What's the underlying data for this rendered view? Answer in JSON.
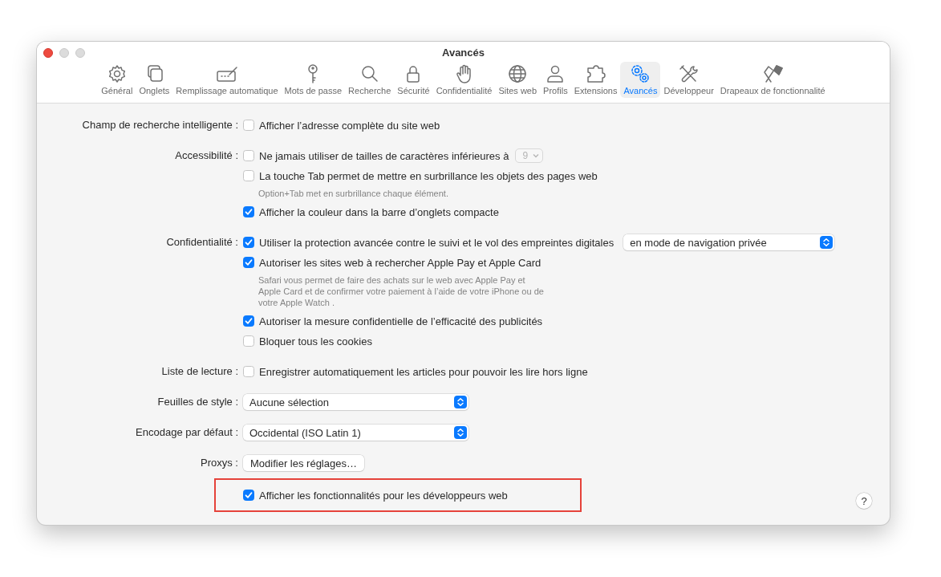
{
  "window": {
    "title": "Avancés"
  },
  "toolbar": [
    {
      "label": "Général",
      "selected": false
    },
    {
      "label": "Onglets",
      "selected": false
    },
    {
      "label": "Remplissage automatique",
      "selected": false
    },
    {
      "label": "Mots de passe",
      "selected": false
    },
    {
      "label": "Recherche",
      "selected": false
    },
    {
      "label": "Sécurité",
      "selected": false
    },
    {
      "label": "Confidentialité",
      "selected": false
    },
    {
      "label": "Sites web",
      "selected": false
    },
    {
      "label": "Profils",
      "selected": false
    },
    {
      "label": "Extensions",
      "selected": false
    },
    {
      "label": "Avancés",
      "selected": true
    },
    {
      "label": "Développeur",
      "selected": false
    },
    {
      "label": "Drapeaux de fonctionnalité",
      "selected": false
    }
  ],
  "sections": [
    {
      "label": "Champ de recherche intelligente :",
      "items": [
        {
          "kind": "checkbox",
          "label": "Afficher l’adresse complète du site web",
          "checked": false
        }
      ]
    },
    {
      "label": "Accessibilité :",
      "items": [
        {
          "kind": "checkbox",
          "label": "Ne jamais utiliser de tailles de caractères inférieures à",
          "checked": false,
          "size_select": {
            "value": "9",
            "disabled": true
          }
        },
        {
          "kind": "checkbox",
          "label": "La touche Tab permet de mettre en surbrillance les objets des pages web",
          "checked": false
        },
        {
          "kind": "note",
          "text": "Option+Tab met en surbrillance chaque élément."
        },
        {
          "kind": "checkbox",
          "label": "Afficher la couleur dans la barre d’onglets compacte",
          "checked": true
        }
      ]
    },
    {
      "label": "Confidentialité :",
      "items": [
        {
          "kind": "checkbox",
          "label": "Utiliser la protection avancée contre le suivi et le vol des empreintes digitales",
          "checked": true,
          "popup": {
            "value": "en mode de navigation privée"
          }
        },
        {
          "kind": "checkbox",
          "label": "Autoriser les sites web à rechercher Apple Pay et Apple Card",
          "checked": true
        },
        {
          "kind": "note",
          "text": "Safari vous permet de faire des achats sur le web avec Apple Pay et\nApple Card et de confirmer votre paiement à l’aide de votre iPhone ou de\nvotre Apple Watch ."
        },
        {
          "kind": "checkbox",
          "label": "Autoriser la mesure confidentielle de l’efficacité des publicités",
          "checked": true
        },
        {
          "kind": "checkbox",
          "label": "Bloquer tous les cookies",
          "checked": false
        }
      ]
    },
    {
      "label": "Liste de lecture :",
      "items": [
        {
          "kind": "checkbox",
          "label": "Enregistrer automatiquement les articles pour pouvoir les lire hors ligne",
          "checked": false
        }
      ]
    },
    {
      "label": "Feuilles de style :",
      "items": [
        {
          "kind": "select",
          "value": "Aucune sélection"
        }
      ]
    },
    {
      "label": "Encodage par défaut :",
      "items": [
        {
          "kind": "select",
          "value": "Occidental (ISO Latin 1)"
        }
      ]
    },
    {
      "label": "Proxys :",
      "items": [
        {
          "kind": "button",
          "label": "Modifier les réglages…"
        }
      ]
    },
    {
      "items": [
        {
          "kind": "checkbox",
          "label": "Afficher les fonctionnalités pour les développeurs web",
          "checked": true,
          "highlighted": true
        }
      ]
    }
  ],
  "help_button": "?"
}
